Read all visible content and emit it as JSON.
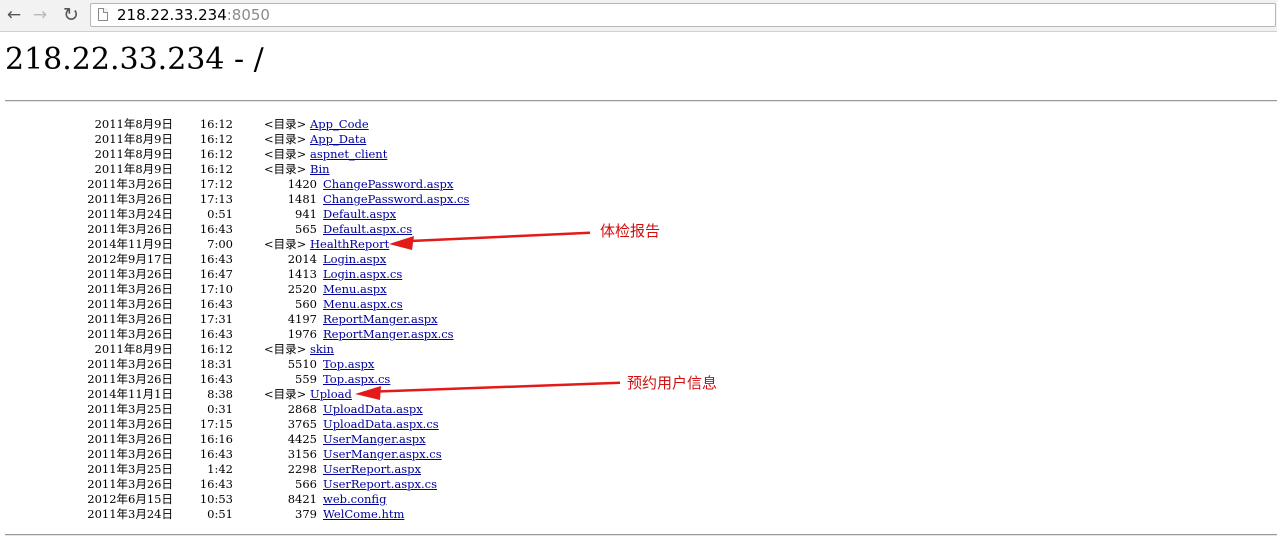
{
  "browser": {
    "url_host": "218.22.33.234",
    "url_port": ":8050",
    "back_glyph": "←",
    "forward_glyph": "→",
    "reload_glyph": "↻"
  },
  "page": {
    "title": "218.22.33.234 - /"
  },
  "listing": [
    {
      "date": "2011年8月9日",
      "time": "16:12",
      "type": "dir",
      "dir_label": "<目录>",
      "size": "",
      "name": "App_Code"
    },
    {
      "date": "2011年8月9日",
      "time": "16:12",
      "type": "dir",
      "dir_label": "<目录>",
      "size": "",
      "name": "App_Data"
    },
    {
      "date": "2011年8月9日",
      "time": "16:12",
      "type": "dir",
      "dir_label": "<目录>",
      "size": "",
      "name": "aspnet_client"
    },
    {
      "date": "2011年8月9日",
      "time": "16:12",
      "type": "dir",
      "dir_label": "<目录>",
      "size": "",
      "name": "Bin"
    },
    {
      "date": "2011年3月26日",
      "time": "17:12",
      "type": "file",
      "dir_label": "",
      "size": "1420",
      "name": "ChangePassword.aspx"
    },
    {
      "date": "2011年3月26日",
      "time": "17:13",
      "type": "file",
      "dir_label": "",
      "size": "1481",
      "name": "ChangePassword.aspx.cs"
    },
    {
      "date": "2011年3月24日",
      "time": "0:51",
      "type": "file",
      "dir_label": "",
      "size": "941",
      "name": "Default.aspx"
    },
    {
      "date": "2011年3月26日",
      "time": "16:43",
      "type": "file",
      "dir_label": "",
      "size": "565",
      "name": "Default.aspx.cs"
    },
    {
      "date": "2014年11月9日",
      "time": "7:00",
      "type": "dir",
      "dir_label": "<目录>",
      "size": "",
      "name": "HealthReport"
    },
    {
      "date": "2012年9月17日",
      "time": "16:43",
      "type": "file",
      "dir_label": "",
      "size": "2014",
      "name": "Login.aspx"
    },
    {
      "date": "2011年3月26日",
      "time": "16:47",
      "type": "file",
      "dir_label": "",
      "size": "1413",
      "name": "Login.aspx.cs"
    },
    {
      "date": "2011年3月26日",
      "time": "17:10",
      "type": "file",
      "dir_label": "",
      "size": "2520",
      "name": "Menu.aspx"
    },
    {
      "date": "2011年3月26日",
      "time": "16:43",
      "type": "file",
      "dir_label": "",
      "size": "560",
      "name": "Menu.aspx.cs"
    },
    {
      "date": "2011年3月26日",
      "time": "17:31",
      "type": "file",
      "dir_label": "",
      "size": "4197",
      "name": "ReportManger.aspx"
    },
    {
      "date": "2011年3月26日",
      "time": "16:43",
      "type": "file",
      "dir_label": "",
      "size": "1976",
      "name": "ReportManger.aspx.cs"
    },
    {
      "date": "2011年8月9日",
      "time": "16:12",
      "type": "dir",
      "dir_label": "<目录>",
      "size": "",
      "name": "skin"
    },
    {
      "date": "2011年3月26日",
      "time": "18:31",
      "type": "file",
      "dir_label": "",
      "size": "5510",
      "name": "Top.aspx"
    },
    {
      "date": "2011年3月26日",
      "time": "16:43",
      "type": "file",
      "dir_label": "",
      "size": "559",
      "name": "Top.aspx.cs"
    },
    {
      "date": "2014年11月1日",
      "time": "8:38",
      "type": "dir",
      "dir_label": "<目录>",
      "size": "",
      "name": "Upload"
    },
    {
      "date": "2011年3月25日",
      "time": "0:31",
      "type": "file",
      "dir_label": "",
      "size": "2868",
      "name": "UploadData.aspx"
    },
    {
      "date": "2011年3月26日",
      "time": "17:15",
      "type": "file",
      "dir_label": "",
      "size": "3765",
      "name": "UploadData.aspx.cs"
    },
    {
      "date": "2011年3月26日",
      "time": "16:16",
      "type": "file",
      "dir_label": "",
      "size": "4425",
      "name": "UserManger.aspx"
    },
    {
      "date": "2011年3月26日",
      "time": "16:43",
      "type": "file",
      "dir_label": "",
      "size": "3156",
      "name": "UserManger.aspx.cs"
    },
    {
      "date": "2011年3月25日",
      "time": "1:42",
      "type": "file",
      "dir_label": "",
      "size": "2298",
      "name": "UserReport.aspx"
    },
    {
      "date": "2011年3月26日",
      "time": "16:43",
      "type": "file",
      "dir_label": "",
      "size": "566",
      "name": "UserReport.aspx.cs"
    },
    {
      "date": "2012年6月15日",
      "time": "10:53",
      "type": "file",
      "dir_label": "",
      "size": "8421",
      "name": "web.config"
    },
    {
      "date": "2011年3月24日",
      "time": "0:51",
      "type": "file",
      "dir_label": "",
      "size": "379",
      "name": "WelCome.htm"
    }
  ],
  "annotations": {
    "health_report": "体检报告",
    "upload": "预约用户信息",
    "color": "#e01010"
  }
}
